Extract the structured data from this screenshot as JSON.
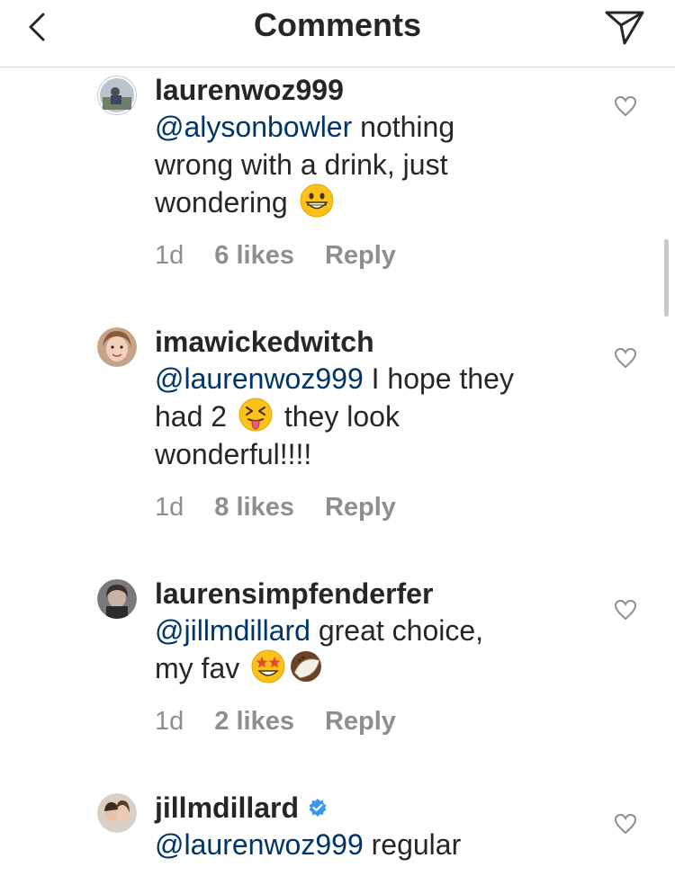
{
  "header": {
    "title": "Comments",
    "back_icon": "chevron-left-icon",
    "share_icon": "paper-plane-icon"
  },
  "comments": [
    {
      "username": "laurenwoz999",
      "mention": "@alysonbowler",
      "text_line1_rest": " nothing",
      "text_line2": "wrong with a drink, just",
      "text_line3": "wondering",
      "emoji": "grinning-face",
      "time": "1d",
      "likes": "6 likes",
      "reply": "Reply"
    },
    {
      "username": "imawickedwitch",
      "mention": "@laurenwoz999",
      "text_line1_rest": "  I hope they",
      "text_line2_a": "had 2",
      "text_line2_b": "they look",
      "text_line3": "wonderful!!!!",
      "emoji": "squinting-tongue-face",
      "time": "1d",
      "likes": "8 likes",
      "reply": "Reply"
    },
    {
      "username": "laurensimpfenderfer",
      "mention": "@jillmdillard",
      "text_line1_rest": " great choice,",
      "text_line2": "my fav",
      "emoji": "star-struck-face",
      "emoji2": "coconut",
      "time": "1d",
      "likes": "2 likes",
      "reply": "Reply"
    },
    {
      "username": "jillmdillard",
      "verified": true,
      "mention": "@laurenwoz999",
      "text_line1_rest": " regular"
    }
  ],
  "colors": {
    "mention": "#003569",
    "meta": "#8e8e8e",
    "verified": "#3897f0"
  }
}
